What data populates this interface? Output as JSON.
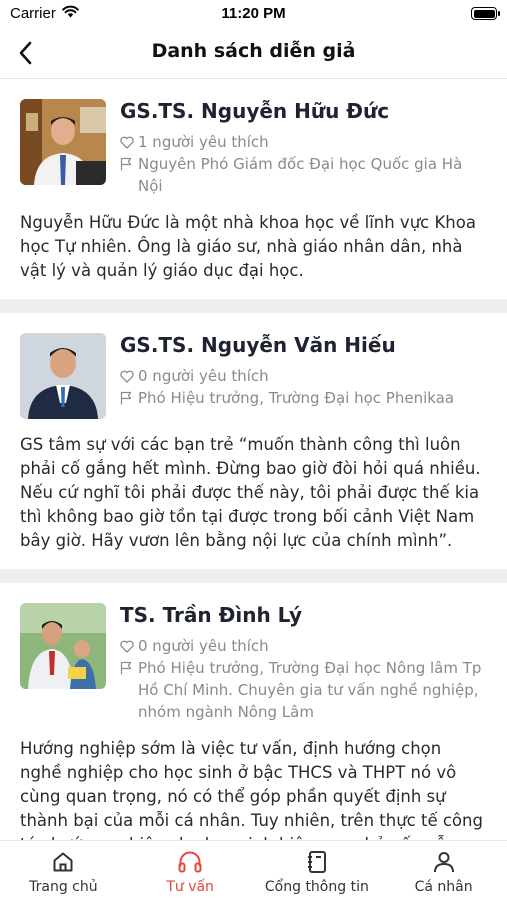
{
  "status_bar": {
    "carrier": "Carrier",
    "time": "11:20 PM"
  },
  "header": {
    "title": "Danh sách diễn giả"
  },
  "speakers": [
    {
      "name": "GS.TS. Nguyễn Hữu Đức",
      "likes": "1 người yêu thích",
      "position": "Nguyên Phó Giám đốc Đại học Quốc gia Hà Nội",
      "description": "Nguyễn Hữu Đức là một nhà khoa học về lĩnh vực Khoa học Tự nhiên. Ông là giáo sư, nhà giáo nhân dân, nhà vật lý và quản lý giáo dục đại học."
    },
    {
      "name": "GS.TS. Nguyễn Văn Hiếu",
      "likes": "0 người yêu thích",
      "position": "Phó Hiệu trưởng, Trường Đại học Phenikaa",
      "description": "GS tâm sự với các bạn trẻ “muốn thành công thì luôn phải cố gắng hết mình. Đừng bao giờ đòi hỏi quá nhiều. Nếu cứ nghĩ tôi phải được thế này, tôi phải được thế kia thì không bao giờ tồn tại được trong bối cảnh Việt Nam bây giờ. Hãy vươn lên bằng nội lực của chính mình”."
    },
    {
      "name": "TS. Trần Đình Lý",
      "likes": "0 người yêu thích",
      "position": "Phó Hiệu trưởng, Trường Đại học Nông lâm Tp Hồ Chí Minh. Chuyên gia tư vấn nghề nghiệp, nhóm ngành Nông Lâm",
      "description": "Hướng nghiệp sớm là việc tư vấn, định hướng chọn nghề nghiệp cho học sinh ở bậc THCS và THPT nó vô cùng quan trọng, nó có thể góp phần quyết định sự thành bại của mỗi cá nhân. Tuy nhiên, trên thực tế công tác hướng nghiệp cho học sinh hiện nay chủ yếu vẫn"
    }
  ],
  "tabbar": {
    "items": [
      {
        "label": "Trang chủ",
        "icon": "home-icon"
      },
      {
        "label": "Tư vấn",
        "icon": "headphones-icon"
      },
      {
        "label": "Cổng thông tin",
        "icon": "notebook-icon"
      },
      {
        "label": "Cá nhân",
        "icon": "person-icon"
      }
    ],
    "active_index": 1,
    "active_color": "#e8453c"
  }
}
